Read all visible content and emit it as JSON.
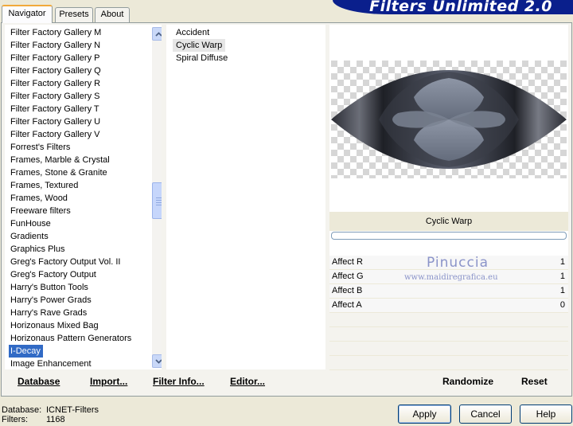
{
  "tabs": [
    "Navigator",
    "Presets",
    "About"
  ],
  "banner_title": "Filters Unlimited 2.0",
  "categories": [
    "Filter Factory Gallery M",
    "Filter Factory Gallery N",
    "Filter Factory Gallery P",
    "Filter Factory Gallery Q",
    "Filter Factory Gallery R",
    "Filter Factory Gallery S",
    "Filter Factory Gallery T",
    "Filter Factory Gallery U",
    "Filter Factory Gallery V",
    "Forrest's Filters",
    "Frames, Marble & Crystal",
    "Frames, Stone & Granite",
    "Frames, Textured",
    "Frames, Wood",
    "Freeware filters",
    "FunHouse",
    "Gradients",
    "Graphics Plus",
    "Greg's Factory Output Vol. II",
    "Greg's Factory Output",
    "Harry's Button Tools",
    "Harry's Power Grads",
    "Harry's Rave Grads",
    "Horizonaus Mixed Bag",
    "Horizonaus Pattern Generators",
    "I-Decay",
    "Image Enhancement"
  ],
  "selected_category": "I-Decay",
  "filters": [
    "Accident",
    "Cyclic Warp",
    "Spiral Diffuse"
  ],
  "selected_filter": "Cyclic Warp",
  "filter_title": "Cyclic Warp",
  "params": [
    {
      "label": "Affect R",
      "value": "1"
    },
    {
      "label": "Affect G",
      "value": "1"
    },
    {
      "label": "Affect B",
      "value": "1"
    },
    {
      "label": "Affect A",
      "value": "0"
    }
  ],
  "watermark": {
    "name": "Pinuccia",
    "site": "www.maidiregrafica.eu"
  },
  "toolbar": {
    "database": "Database",
    "import": "Import...",
    "filter_info": "Filter Info...",
    "editor": "Editor...",
    "randomize": "Randomize",
    "reset": "Reset"
  },
  "status": {
    "database_label": "Database:",
    "database_value": "ICNET-Filters",
    "filters_label": "Filters:",
    "filters_value": "1168"
  },
  "buttons": {
    "apply": "Apply",
    "cancel": "Cancel",
    "help": "Help"
  },
  "colors": {
    "banner": "#0a1f8c",
    "selection": "#316ac5",
    "tab_accent": "#f1a93a"
  }
}
